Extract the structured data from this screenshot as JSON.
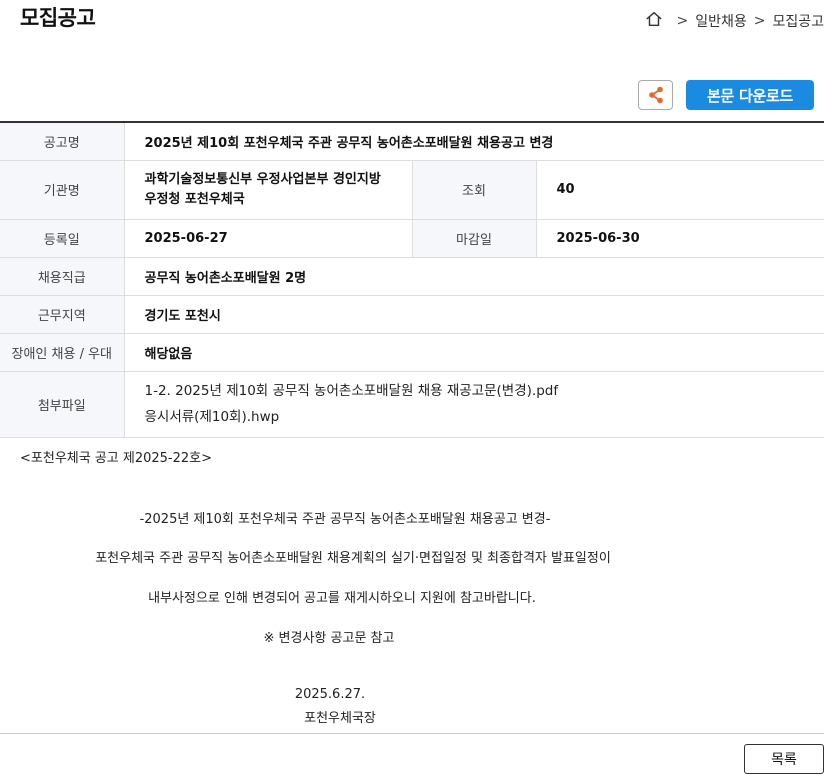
{
  "page": {
    "title": "모집공고"
  },
  "breadcrumb": {
    "items": [
      "일반채용",
      "모집공고"
    ],
    "sep": ">"
  },
  "toolbar": {
    "download_label": "본문 다운로드"
  },
  "info": {
    "notice_title_label": "공고명",
    "notice_title": "2025년 제10회 포천우체국 주관 공무직 농어촌소포배달원 채용공고 변경",
    "org_label": "기관명",
    "org_line1": "과학기술정보통신부 우정사업본부 경인지방",
    "org_line2": "우정청 포천우체국",
    "views_label": "조회",
    "views": "40",
    "reg_date_label": "등록일",
    "reg_date": "2025-06-27",
    "deadline_label": "마감일",
    "deadline": "2025-06-30",
    "position_label": "채용직급",
    "position": "공무직 농어촌소포배달원 2명",
    "region_label": "근무지역",
    "region": "경기도 포천시",
    "disability_label": "장애인 채용 / 우대",
    "disability": "해당없음",
    "files_label": "첨부파일",
    "files": [
      "1-2. 2025년 제10회 공무직 농어촌소포배달원 채용 재공고문(변경).pdf",
      "응시서류(제10회).hwp"
    ]
  },
  "content": {
    "notice_no": "<포천우체국 공고 제2025-22호>",
    "line1": "-2025년 제10회 포천우체국 주관 공무직 농어촌소포배달원 채용공고 변경-",
    "line2": "포천우체국 주관 공무직 농어촌소포배달원 채용계획의 실기·면접일정 및 최종합격자 발표일정이",
    "line3": "내부사정으로 인해 변경되어 공고를 재게시하오니 지원에 참고바랍니다.",
    "line4": "※ 변경사항 공고문 참고",
    "date": "2025.6.27.",
    "signer": "포천우체국장"
  },
  "footer": {
    "list_label": "목록"
  },
  "colors": {
    "accent": "#1a8be0",
    "share_icon": "#e4672e"
  }
}
